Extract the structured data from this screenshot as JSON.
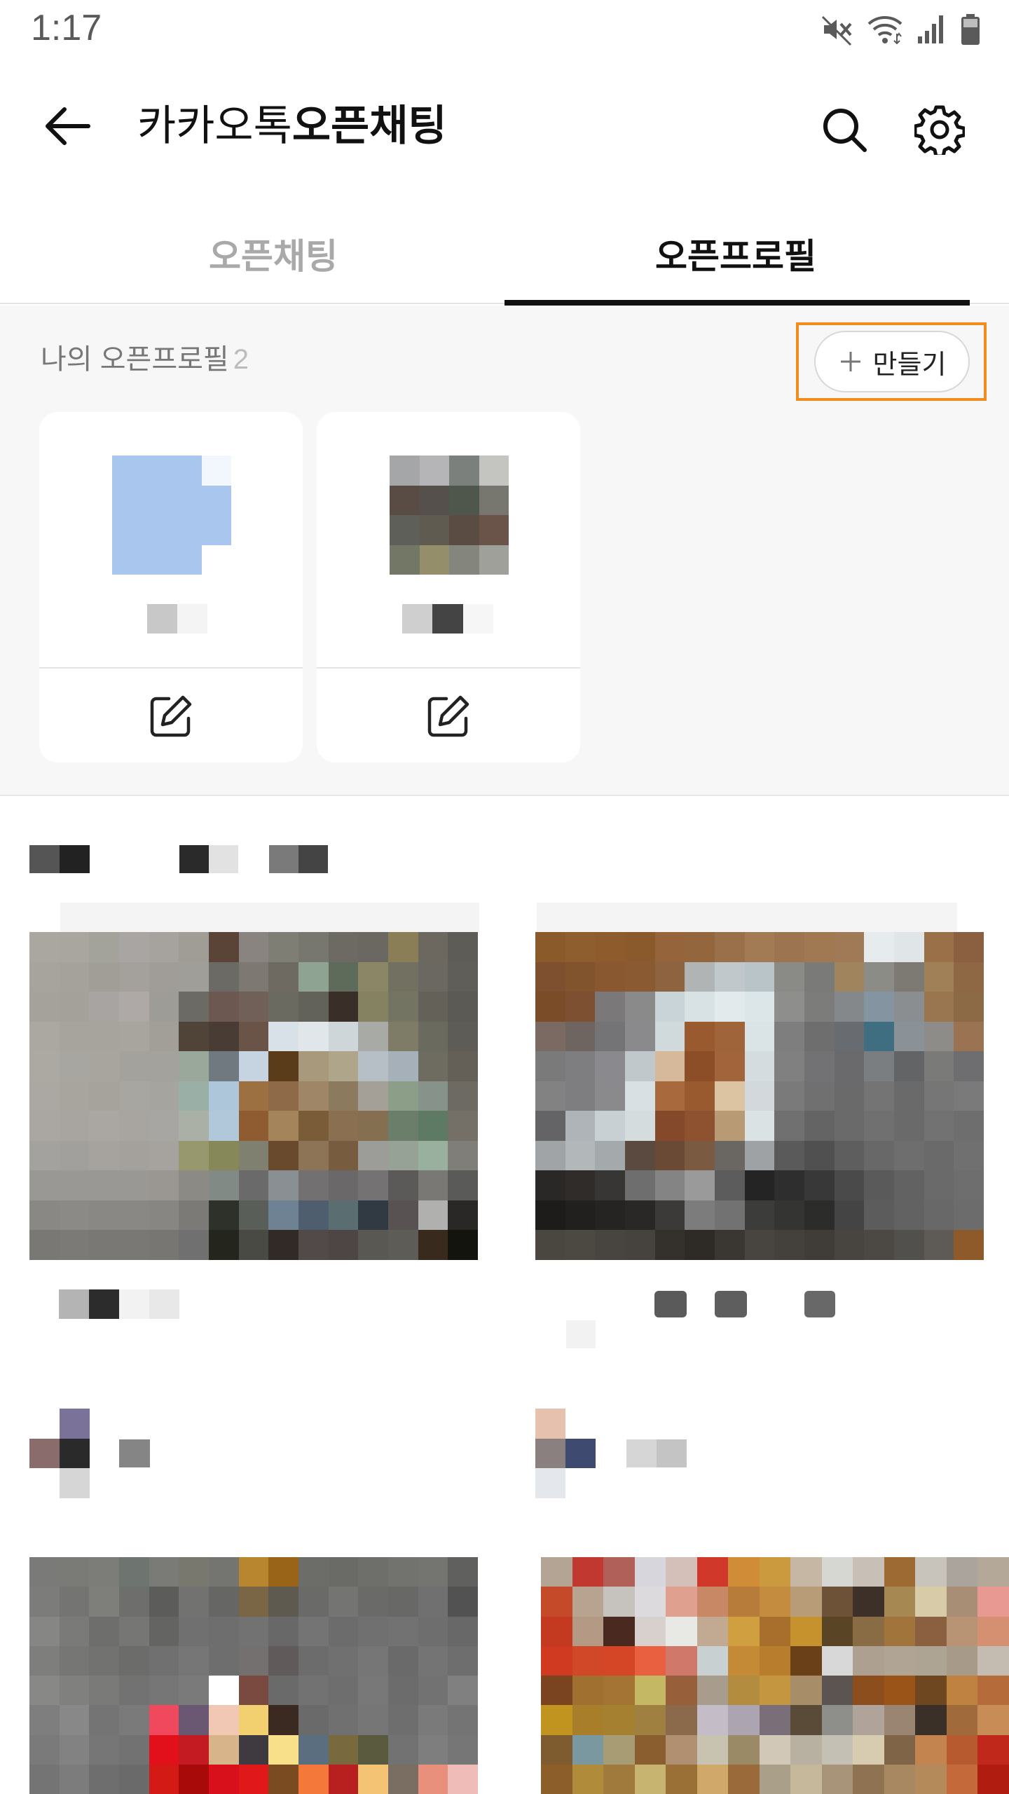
{
  "status_bar": {
    "time": "1:17",
    "icons": [
      "mute-icon",
      "wifi-icon",
      "signal-icon",
      "battery-icon"
    ]
  },
  "app_bar": {
    "title_regular": "카카오톡",
    "title_bold": "오픈채팅",
    "icons": [
      "back-arrow-icon",
      "search-icon",
      "gear-icon"
    ]
  },
  "tabs": [
    {
      "label": "오픈채팅",
      "active": false
    },
    {
      "label": "오픈프로필",
      "active": true
    }
  ],
  "my_profiles": {
    "label": "나의 오픈프로필",
    "count": "2",
    "create_label": "만들기",
    "create_icon": "plus-icon",
    "highlight_color": "#f08c1e",
    "cards": [
      {
        "edit_icon": "edit-icon"
      },
      {
        "edit_icon": "edit-icon"
      }
    ]
  }
}
